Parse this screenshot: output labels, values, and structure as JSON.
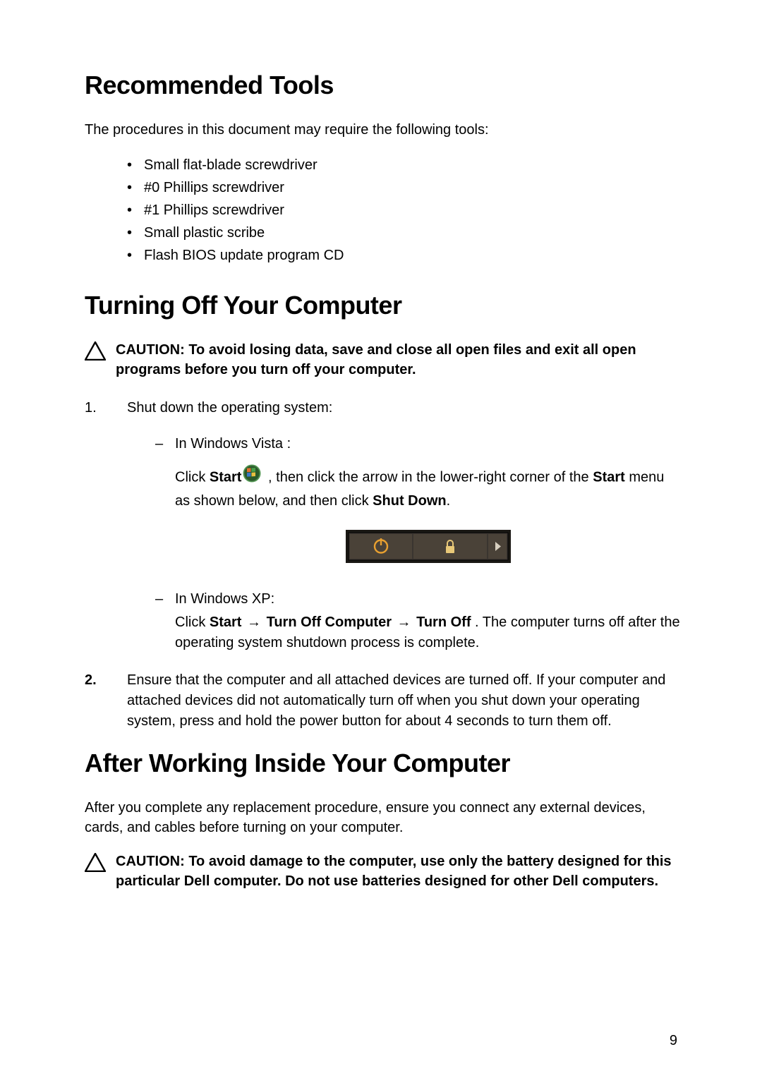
{
  "section1": {
    "heading": "Recommended Tools",
    "intro": "The procedures in this document may require the following tools:",
    "items": [
      "Small flat-blade screwdriver",
      "#0 Phillips screwdriver",
      "#1 Phillips screwdriver",
      "Small plastic scribe",
      "Flash BIOS update program CD"
    ]
  },
  "section2": {
    "heading": "Turning Off Your Computer",
    "caution": "CAUTION: To avoid losing data, save and close all open files and exit all open programs before you turn off your computer.",
    "step1_intro": "Shut down the operating system:",
    "vista_label": "In Windows Vista :",
    "vista_click": "Click ",
    "vista_start": "Start",
    "vista_rest1": " , then click the arrow in the lower-right corner of the ",
    "vista_start2": "Start",
    "vista_rest2": " menu as shown below, and then click ",
    "vista_shutdown": "Shut Down",
    "vista_rest3": ".",
    "xp_label": "In Windows XP:",
    "xp_click": "Click ",
    "xp_start": "Start",
    "xp_arrow1": " → ",
    "xp_turnoffcomp": "Turn Off Computer",
    "xp_arrow2": " → ",
    "xp_turnoff": "Turn Off",
    "xp_rest": " . The computer turns off after the operating system shutdown process is complete.",
    "step2": "Ensure that the computer and all attached devices are turned off. If your computer and attached devices did not automatically turn off when you shut down your operating system, press and hold the power button for about 4 seconds to turn them off."
  },
  "section3": {
    "heading": "After Working Inside Your Computer",
    "intro": "After you complete any replacement procedure, ensure you connect any external devices, cards, and cables before turning on your computer.",
    "caution": "CAUTION: To avoid damage to the computer, use only the battery designed for this particular Dell computer. Do not use batteries designed for other Dell computers."
  },
  "page_number": "9"
}
